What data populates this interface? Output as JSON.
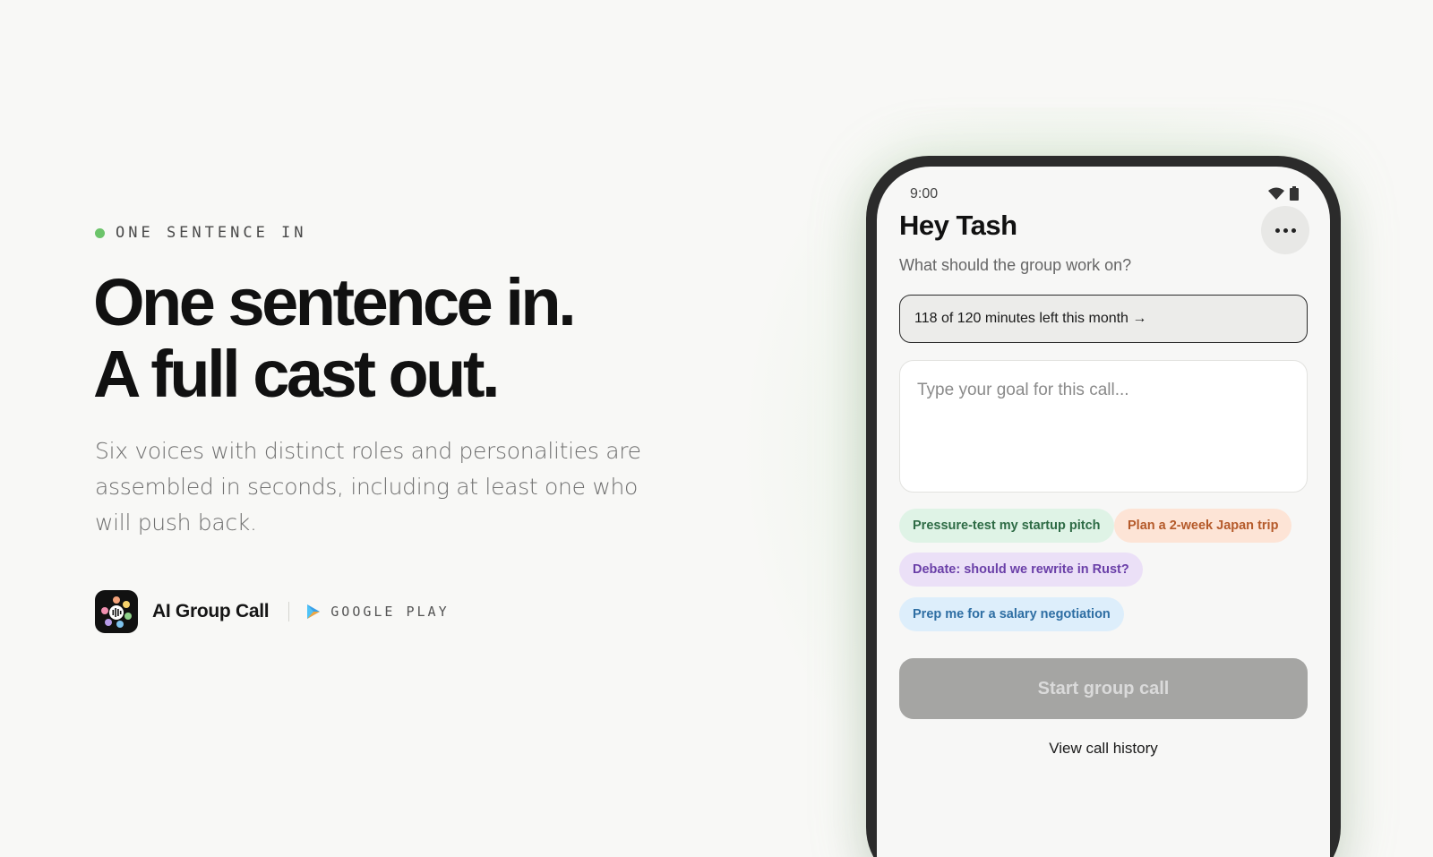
{
  "hero": {
    "eyebrow": "ONE SENTENCE IN",
    "headline_line1": "One sentence in.",
    "headline_line2": "A full cast out.",
    "subtitle": "Six voices with distinct roles and personalities are assembled in seconds, including at least one who will push back."
  },
  "brand": {
    "app_name": "AI Group Call",
    "store_label": "GOOGLE PLAY"
  },
  "phone": {
    "status_time": "9:00",
    "greeting": "Hey Tash",
    "prompt": "What should the group work on?",
    "minutes_banner": "118 of 120 minutes left this month →",
    "goal_placeholder": "Type your goal for this call...",
    "suggestions": [
      "Pressure-test my startup pitch",
      "Plan a 2-week Japan trip",
      "Debate: should we rewrite in Rust?",
      "Prep me for a salary negotiation"
    ],
    "start_button": "Start group call",
    "history_link": "View call history"
  },
  "colors": {
    "eyebrow_dot": "#6cc46a",
    "chip_green": "#dff3e6",
    "chip_orange": "#fde4d6",
    "chip_purple": "#ebe0f7",
    "chip_blue": "#ddeefb",
    "start_button_disabled": "#a5a5a3"
  },
  "icons": {
    "more": "more-horizontal-icon",
    "wifi": "wifi-icon",
    "battery": "battery-icon",
    "play": "google-play-icon",
    "app": "app-logo-icon"
  }
}
